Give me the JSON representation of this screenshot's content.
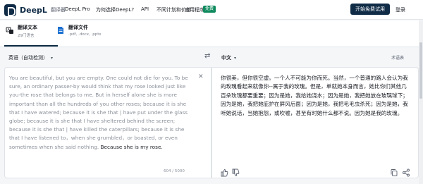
{
  "nav": {
    "brand": "DeepL",
    "brand_sub": "翻译器",
    "links": [
      "DeepL Pro",
      "为何选择DeepL?",
      "API",
      "不同计划和价格",
      "应用程序"
    ],
    "new_badge": "免费",
    "trial_button": "开始免费试用",
    "login": "登录"
  },
  "modes": {
    "text": {
      "title": "翻译文本",
      "sub": "29门语言"
    },
    "files": {
      "title": "翻译文件",
      "sub": ".pdf, .docx, .pptx"
    }
  },
  "langbar": {
    "source": "英语（自动检测）",
    "target": "中文",
    "glossary": "术语表"
  },
  "source": {
    "text_gray": "You are beautiful, but you are empty. One could not die for you. To be sure, an ordinary passer-by would think that my rose looked just like you-the rose that belongs to me. But in herself alone she is more important than all the hundreds of you other roses; because it is she that I have watered; because it is she that | have put under the glass globe; because it is she that I have sheltered behind the screen; because it is she that | have killed the caterpillars; because it is she that I have listened to，when she grumbled，or boasted, or even sometimes when she said nothing.",
    "text_dark": " Because she is my rose.",
    "counter": "604 / 5000"
  },
  "target": {
    "text": "你很美，但你很空虚。一个人不可能为你而死。当然，一个普通的路人会认为我的玫瑰看起来就像你--属于我的玫瑰。但是，单就她本身而言，她比你们其他几百朵玫瑰都要重要；因为是她，我给她浇水；因为是她，我把她放在玻璃球下；因为是她，我把她庇护在屏风后面；因为是她，我把毛毛虫杀死；因为是她，我听她说话，当她抱怨，或吹嘘，甚至有时她什么都不说。因为她是我的玫瑰。"
  },
  "colors": {
    "brand": "#0f2b46",
    "badge": "#0f8a5f",
    "muted_text": "#8a909a"
  }
}
